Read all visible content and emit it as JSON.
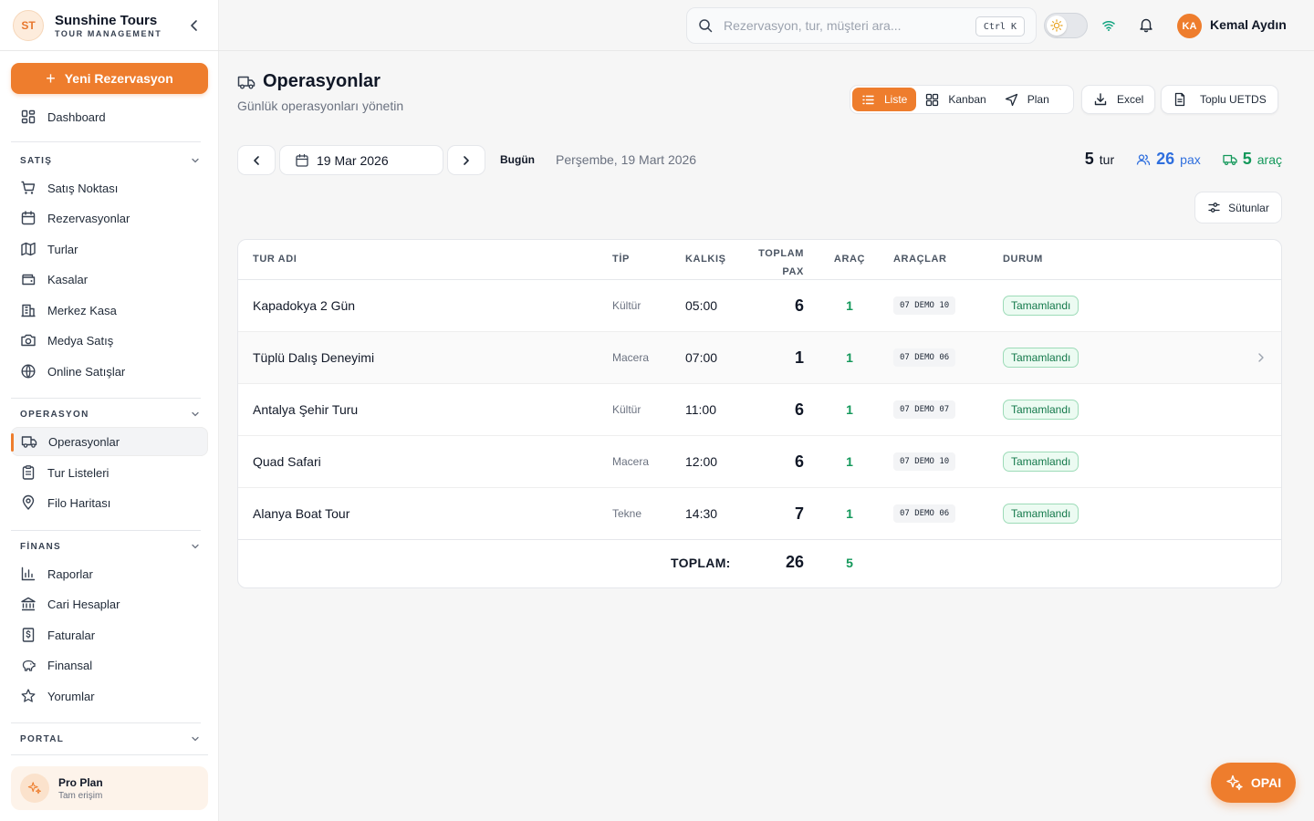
{
  "brand": {
    "logo": "ST",
    "name": "Sunshine Tours",
    "subtitle": "TOUR MANAGEMENT"
  },
  "sidebar": {
    "new_button": "Yeni Rezervasyon",
    "dashboard": "Dashboard",
    "sections": [
      {
        "title": "SATIŞ",
        "items": [
          "Satış Noktası",
          "Rezervasyonlar",
          "Turlar",
          "Kasalar",
          "Merkez Kasa",
          "Medya Satış",
          "Online Satışlar"
        ]
      },
      {
        "title": "OPERASYON",
        "items": [
          "Operasyonlar",
          "Tur Listeleri",
          "Filo Haritası"
        ]
      },
      {
        "title": "FİNANS",
        "items": [
          "Raporlar",
          "Cari Hesaplar",
          "Faturalar",
          "Finansal",
          "Yorumlar"
        ]
      },
      {
        "title": "PORTAL",
        "items": []
      }
    ],
    "active_item": "Operasyonlar",
    "plan": {
      "title": "Pro Plan",
      "subtitle": "Tam erişim"
    }
  },
  "header": {
    "search_placeholder": "Rezervasyon, tur, müşteri ara...",
    "shortcut": "Ctrl K",
    "user": {
      "initials": "KA",
      "name": "Kemal Aydın"
    }
  },
  "page": {
    "title": "Operasyonlar",
    "subtitle": "Günlük operasyonları yönetin",
    "views": {
      "list": "Liste",
      "kanban": "Kanban",
      "plan": "Plan",
      "active": "Liste"
    },
    "excel": "Excel",
    "uetds": "Toplu UETDS",
    "date": "19 Mar 2026",
    "today": "Bugün",
    "long_date": "Perşembe, 19 Mart 2026",
    "stats": {
      "tur_num": "5",
      "tur_label": "tur",
      "pax_num": "26",
      "pax_label": "pax",
      "arac_num": "5",
      "arac_label": "araç"
    },
    "columns_button": "Sütunlar"
  },
  "table": {
    "headers": {
      "name": "TUR ADI",
      "type": "TİP",
      "time": "KALKIŞ",
      "pax_1": "TOPLAM",
      "pax_2": "PAX",
      "arac": "ARAÇ",
      "araclar": "ARAÇLAR",
      "status": "DURUM"
    },
    "rows": [
      {
        "name": "Kapadokya 2 Gün",
        "type": "Kültür",
        "time": "05:00",
        "pax": "6",
        "arac": "1",
        "plate": "07 DEMO 10",
        "status": "Tamamlandı"
      },
      {
        "name": "Tüplü Dalış Deneyimi",
        "type": "Macera",
        "time": "07:00",
        "pax": "1",
        "arac": "1",
        "plate": "07 DEMO 06",
        "status": "Tamamlandı"
      },
      {
        "name": "Antalya Şehir Turu",
        "type": "Kültür",
        "time": "11:00",
        "pax": "6",
        "arac": "1",
        "plate": "07 DEMO 07",
        "status": "Tamamlandı"
      },
      {
        "name": "Quad Safari",
        "type": "Macera",
        "time": "12:00",
        "pax": "6",
        "arac": "1",
        "plate": "07 DEMO 10",
        "status": "Tamamlandı"
      },
      {
        "name": "Alanya Boat Tour",
        "type": "Tekne",
        "time": "14:30",
        "pax": "7",
        "arac": "1",
        "plate": "07 DEMO 06",
        "status": "Tamamlandı"
      }
    ],
    "total": {
      "label": "TOPLAM:",
      "pax": "26",
      "arac": "5"
    }
  },
  "assistant": {
    "label": "OPAI"
  },
  "colors": {
    "accent": "#ee7d2d",
    "pax": "#2f6fde",
    "vehicle": "#13985a",
    "status": "#13784a"
  }
}
